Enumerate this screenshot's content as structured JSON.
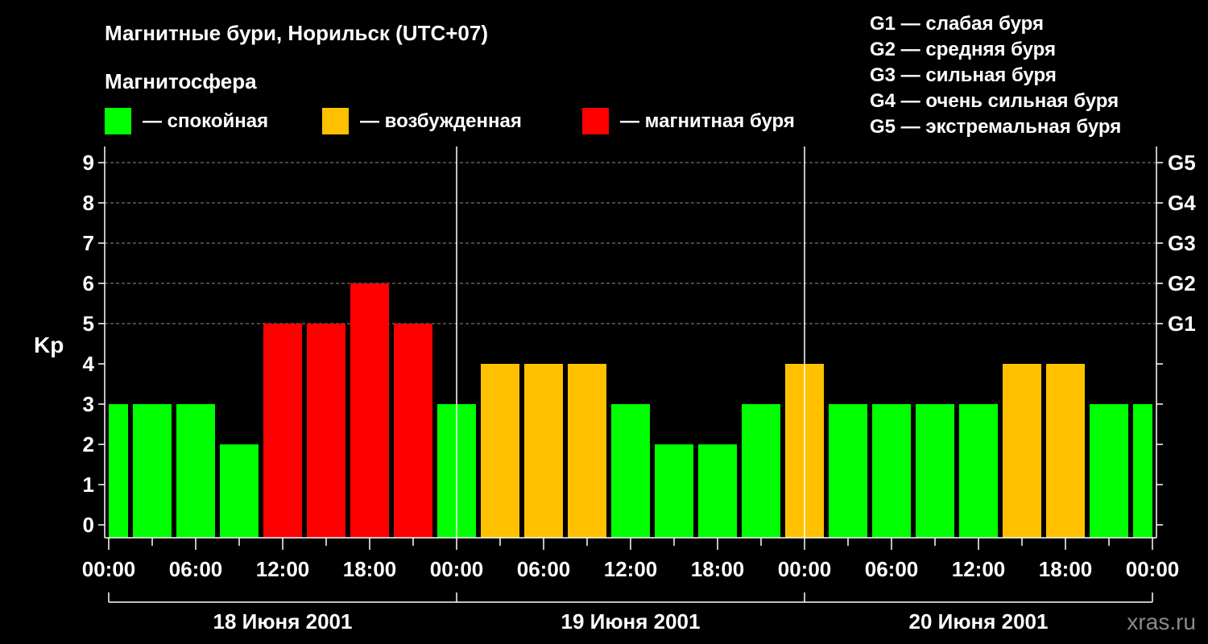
{
  "chart_data": {
    "type": "bar",
    "title": "Магнитные бури, Норильск (UTC+07)",
    "legend_title": "Магнитосфера",
    "legend": [
      {
        "label": "— спокойная",
        "color": "#00ff00"
      },
      {
        "label": "— возбужденная",
        "color": "#ffc000"
      },
      {
        "label": "— магнитная буря",
        "color": "#ff0000"
      }
    ],
    "storm_levels": [
      {
        "level": "G1",
        "label": "G1 — слабая буря",
        "kp": 5
      },
      {
        "level": "G2",
        "label": "G2 — средняя буря",
        "kp": 6
      },
      {
        "level": "G3",
        "label": "G3 — сильная буря",
        "kp": 7
      },
      {
        "level": "G4",
        "label": "G4 — очень сильная буря",
        "kp": 8
      },
      {
        "level": "G5",
        "label": "G5 — экстремальная буря",
        "kp": 9
      }
    ],
    "ylabel": "Kp",
    "ylim": [
      0,
      9
    ],
    "yticks": [
      0,
      1,
      2,
      3,
      4,
      5,
      6,
      7,
      8,
      9
    ],
    "x_tick_labels": [
      "00:00",
      "06:00",
      "12:00",
      "18:00",
      "00:00",
      "06:00",
      "12:00",
      "18:00",
      "00:00",
      "06:00",
      "12:00",
      "18:00",
      "00:00"
    ],
    "days": [
      "18 Июня 2001",
      "19 Июня 2001",
      "20 Июня 2001"
    ],
    "hours_per_bar": 3,
    "series": [
      {
        "values": [
          3,
          3,
          3,
          2,
          5,
          5,
          6,
          5,
          3,
          4,
          4,
          4,
          3,
          2,
          2,
          3,
          4,
          3,
          3,
          3,
          3,
          4,
          4,
          3,
          3
        ],
        "status": [
          "calm",
          "calm",
          "calm",
          "calm",
          "storm",
          "storm",
          "storm",
          "storm",
          "calm",
          "excited",
          "excited",
          "excited",
          "calm",
          "calm",
          "calm",
          "calm",
          "excited",
          "calm",
          "calm",
          "calm",
          "calm",
          "excited",
          "excited",
          "calm",
          "calm"
        ]
      }
    ],
    "status_colors": {
      "calm": "#00ff00",
      "excited": "#ffc000",
      "storm": "#ff0000"
    },
    "grid": "dashed horizontal at Kp 5-9",
    "watermark": "xras.ru"
  }
}
